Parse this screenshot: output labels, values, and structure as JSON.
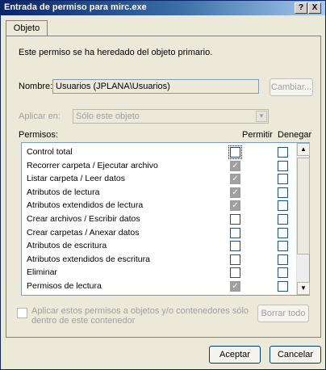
{
  "window": {
    "title": "Entrada de permiso para mirc.exe",
    "help_label": "?",
    "close_label": "X"
  },
  "tabs": [
    {
      "label": "Objeto"
    }
  ],
  "inherited_msg": "Este permiso se ha heredado del objeto primario.",
  "name_field": {
    "label": "Nombre:",
    "value": "Usuarios (JPLANA\\Usuarios)",
    "change_button": "Cambiar..."
  },
  "apply_to": {
    "label": "Aplicar en:",
    "value": "Sólo este objeto"
  },
  "permissions": {
    "header": "Permisos:",
    "allow_header": "Permitir",
    "deny_header": "Denegar",
    "rows": [
      {
        "name": "Control total",
        "allow": false,
        "deny": false
      },
      {
        "name": "Recorrer carpeta / Ejecutar archivo",
        "allow": true,
        "deny": false
      },
      {
        "name": "Listar carpeta / Leer datos",
        "allow": true,
        "deny": false
      },
      {
        "name": "Atributos de lectura",
        "allow": true,
        "deny": false
      },
      {
        "name": "Atributos extendidos de lectura",
        "allow": true,
        "deny": false
      },
      {
        "name": "Crear archivos / Escribir datos",
        "allow": false,
        "deny": false
      },
      {
        "name": "Crear carpetas / Anexar datos",
        "allow": false,
        "deny": false
      },
      {
        "name": "Atributos de escritura",
        "allow": false,
        "deny": false
      },
      {
        "name": "Atributos extendidos de escritura",
        "allow": false,
        "deny": false
      },
      {
        "name": "Eliminar",
        "allow": false,
        "deny": false
      },
      {
        "name": "Permisos de lectura",
        "allow": true,
        "deny": false
      }
    ]
  },
  "apply_children": {
    "label_line1": "Aplicar estos permisos a objetos y/o contenedores sólo",
    "label_line2": "dentro de este contenedor",
    "clear_button": "Borrar todo"
  },
  "footer": {
    "ok_button": "Aceptar",
    "cancel_button": "Cancelar"
  }
}
